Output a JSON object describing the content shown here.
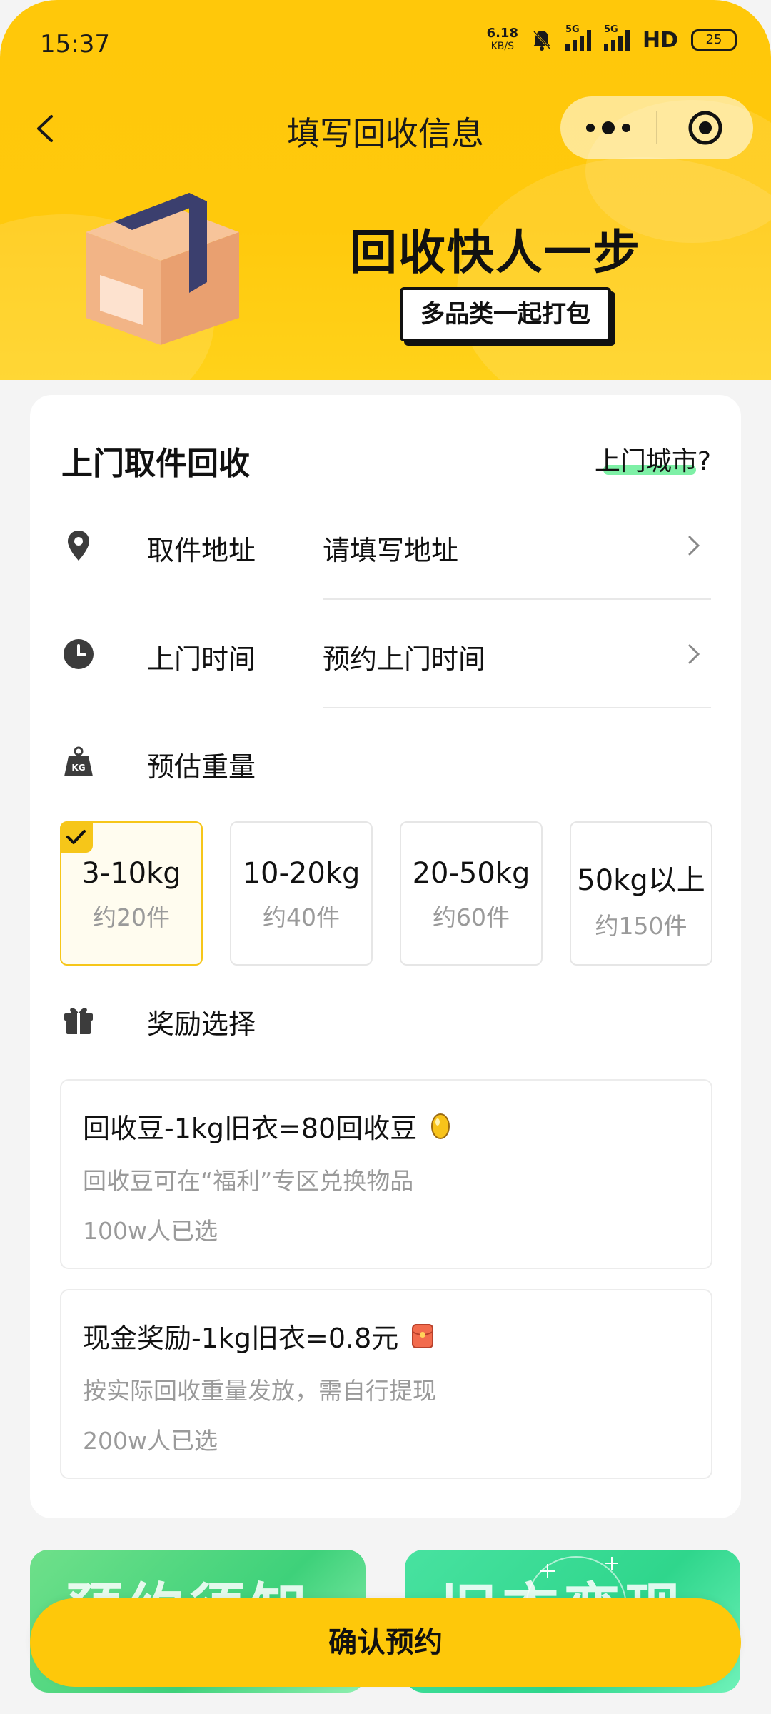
{
  "status_bar": {
    "time": "15:37",
    "net_speed": "6.18",
    "net_unit": "KB/S",
    "signal1": "5G",
    "signal2": "5G",
    "hd": "HD",
    "battery": "25"
  },
  "nav": {
    "title": "填写回收信息"
  },
  "banner": {
    "slogan": "回收快人一步",
    "tag": "多品类一起打包"
  },
  "pickup": {
    "title": "上门取件回收",
    "city_link": "上门城市?",
    "address_label": "取件地址",
    "address_placeholder": "请填写地址",
    "time_label": "上门时间",
    "time_placeholder": "预约上门时间",
    "weight_label": "预估重量"
  },
  "weights": [
    {
      "range": "3-10kg",
      "count": "约20件",
      "selected": true
    },
    {
      "range": "10-20kg",
      "count": "约40件",
      "selected": false
    },
    {
      "range": "20-50kg",
      "count": "约60件",
      "selected": false
    },
    {
      "range": "50kg以上",
      "count": "约150件",
      "selected": false
    }
  ],
  "rewards": {
    "label": "奖励选择",
    "items": [
      {
        "title": "回收豆-1kg旧衣=80回收豆",
        "desc": "回收豆可在“福利”专区兑换物品",
        "chosen": "100w人已选",
        "icon": "bean-icon"
      },
      {
        "title": "现金奖励-1kg旧衣=0.8元",
        "desc": "按实际回收重量发放，需自行提现",
        "chosen": "200w人已选",
        "icon": "red-packet-icon"
      }
    ]
  },
  "promos": {
    "left": "预约须知",
    "right": "旧衣变现"
  },
  "confirm_button": "确认预约",
  "colors": {
    "brand_yellow": "#FEC80A",
    "highlight_green": "#7EF0A6",
    "muted_text": "#9A9A9A"
  }
}
